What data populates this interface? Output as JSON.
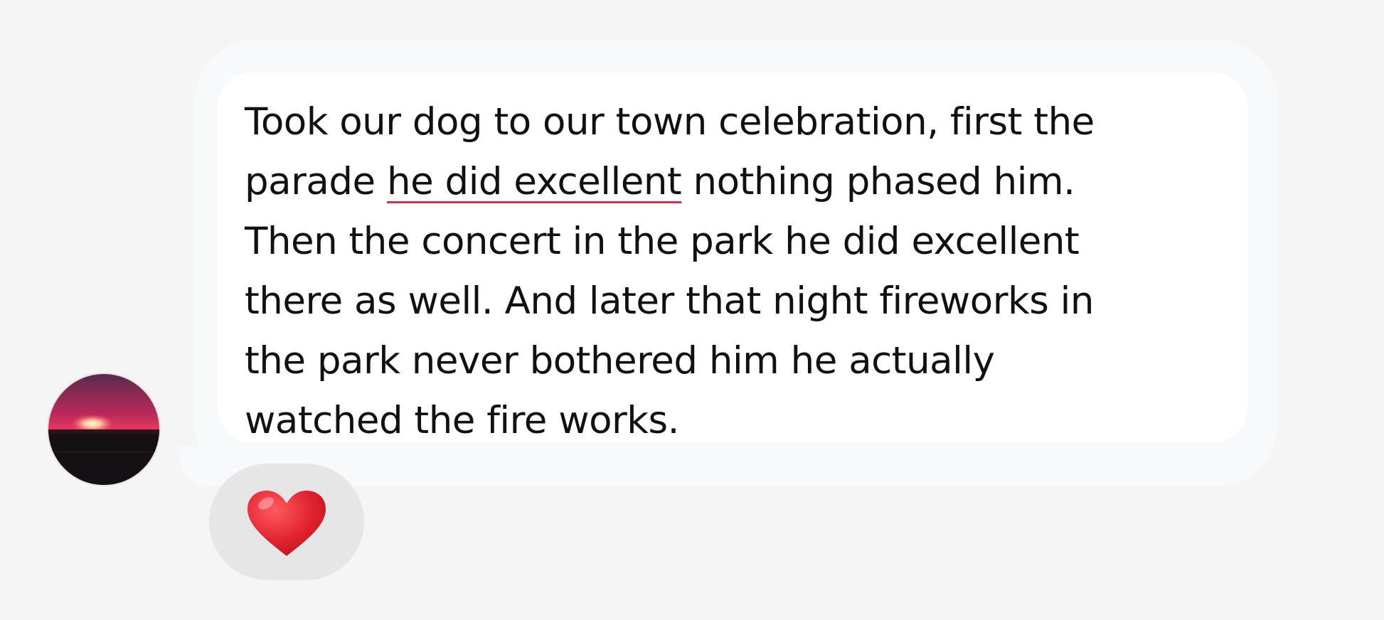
{
  "message": {
    "lines": [
      {
        "text": "Took our dog to our town celebration, first the"
      },
      {
        "before": "parade ",
        "underlined": "he did excellent",
        "after": " nothing phased him."
      },
      {
        "text": "Then the concert in the park he did excellent"
      },
      {
        "text": "there as well. And later that night fireworks in"
      },
      {
        "text": "the park never bothered him he actually"
      },
      {
        "text": "watched the fire works."
      }
    ]
  },
  "reaction": {
    "icon": "red-heart-icon",
    "emoji_color": "#e0232e"
  },
  "avatar": {
    "icon": "sunset-avatar"
  },
  "colors": {
    "background": "#f4f5f4",
    "bubble": "#ffffff",
    "underline": "#c8344e",
    "reaction_background": "#e6e6e6"
  }
}
